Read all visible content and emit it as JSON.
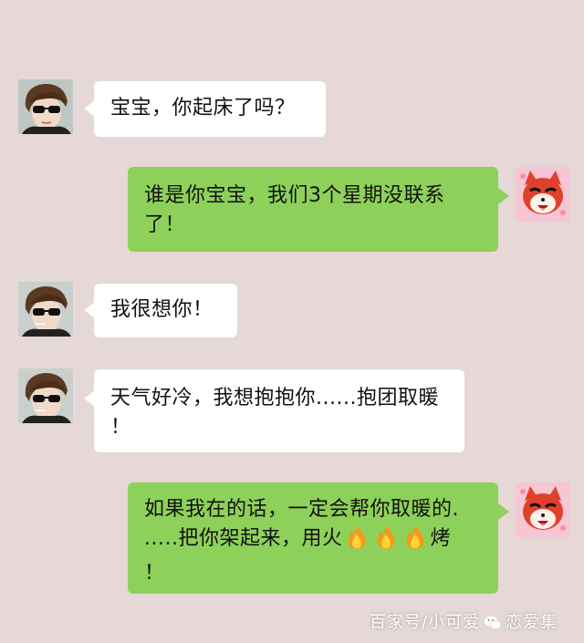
{
  "colors": {
    "background": "#e5d8d6",
    "incoming_bubble": "#ffffff",
    "outgoing_bubble": "#8ed15a"
  },
  "messages": [
    {
      "side": "incoming",
      "avatar": "sunglasses-man-avatar",
      "lines": [
        "宝宝，你起床了吗？"
      ]
    },
    {
      "side": "outgoing",
      "avatar": "red-fox-cartoon-avatar",
      "lines": [
        "谁是你宝宝，我们3个星期没联系",
        "了！"
      ]
    },
    {
      "side": "incoming",
      "avatar": "sunglasses-man-avatar",
      "lines": [
        "我很想你！"
      ]
    },
    {
      "side": "incoming",
      "avatar": "sunglasses-man-avatar",
      "lines": [
        "天气好冷，我想抱抱你......抱团取暖",
        "！"
      ]
    },
    {
      "side": "outgoing",
      "avatar": "red-fox-cartoon-avatar",
      "lines": [
        "如果我在的话，一定会帮你取暖的.",
        ".....把你架起来，用火",
        "烤",
        "！"
      ],
      "emoji": "fire-icon"
    }
  ],
  "watermark": {
    "prefix": "百家号/小可爱",
    "suffix": "恋爱集"
  }
}
